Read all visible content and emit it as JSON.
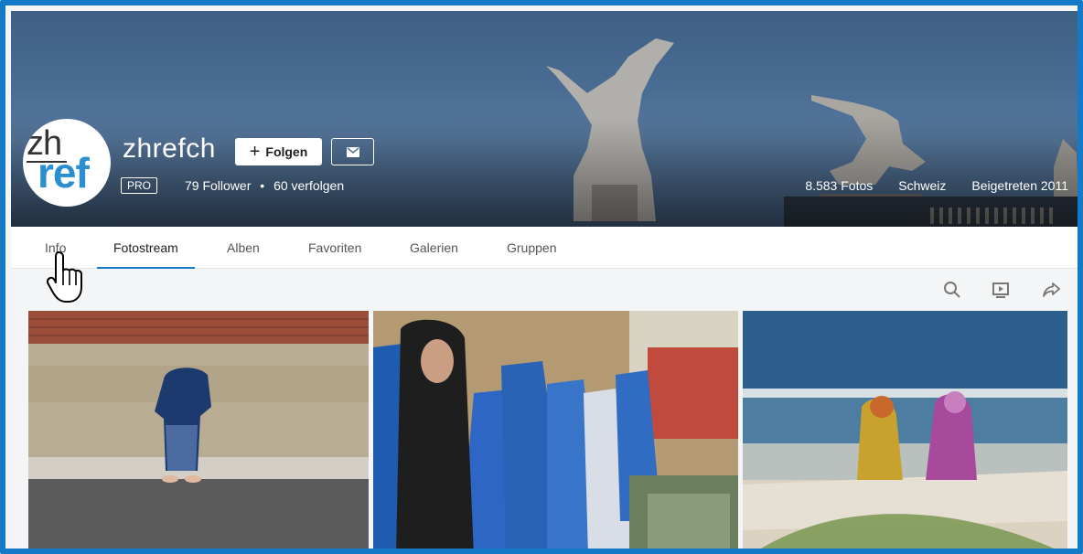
{
  "profile": {
    "avatar_text_top": "zh",
    "avatar_text_bottom": "ref",
    "username": "zhrefch",
    "follow_label": "Folgen",
    "pro_badge": "PRO",
    "followers": "79 Follower",
    "following": "60 verfolgen",
    "photos_count": "8.583 Fotos",
    "location": "Schweiz",
    "joined": "Beigetreten 2011"
  },
  "nav": {
    "tabs": [
      {
        "label": "Info",
        "active": false
      },
      {
        "label": "Fotostream",
        "active": true
      },
      {
        "label": "Alben",
        "active": false
      },
      {
        "label": "Favoriten",
        "active": false
      },
      {
        "label": "Galerien",
        "active": false
      },
      {
        "label": "Gruppen",
        "active": false
      }
    ]
  },
  "toolbar": {
    "icons": [
      "search-icon",
      "slideshow-icon",
      "share-icon"
    ]
  },
  "colors": {
    "accent": "#1479c6",
    "frame": "#1479c6"
  }
}
